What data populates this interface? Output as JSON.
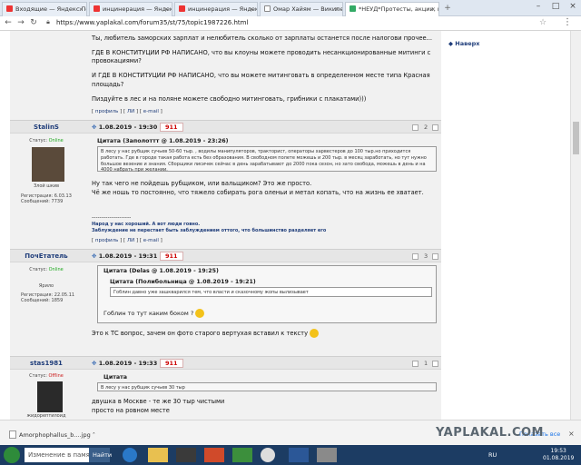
{
  "browser": {
    "tabs": [
      {
        "label": "Входящие — Яндекс.Почта"
      },
      {
        "label": "инцинерация — Яндекс: нашлось"
      },
      {
        "label": "инцинерация — Яндекс нашлос"
      },
      {
        "label": "Омар Хайям — Википедия"
      },
      {
        "label": "*НЕУД*Протесты, акции, митинги"
      }
    ],
    "url": "https://www.yaplakal.com/forum35/st/75/topic1987226.html"
  },
  "right": {
    "up": "◆ Наверх"
  },
  "top_post": {
    "lines": [
      "Ты, любитель заморских зарплат и нелюбитель сколько от зарплаты останется после налогови прочее...",
      "ГДЕ В КОНСТИТУЦИИ РФ НАПИСАНО, что вы клоуны можете проводить несанкционированные митинги с провокациями?",
      "И ГДЕ В КОНСТИТУЦИИ РФ НАПИСАНО, что вы можете митинговать в определенном месте типа Красная площадь?",
      "Пиздуйте в лес и на поляне можете свободно митинговать, грибники с плакатами)))"
    ],
    "links": [
      "профиль",
      "ЛИ",
      "e-mail"
    ]
  },
  "posts": [
    {
      "nick": "StalinS",
      "status_label": "Статус:",
      "status": "Online",
      "rank": "Злой шкив",
      "reg": "Регистрация: 6.03.13",
      "msgs": "Сообщений: 7739",
      "date": "1.08.2019 - 19:30",
      "num": "911",
      "count": "2",
      "quote_title": "Цитата (Заполоттт @ 1.08.2019 - 23:26)",
      "quote": "В лесу у нас рубщик сучьев 50-60 тыр. , водилы манипуляторов, тракторист, операторы харвестеров до 100 тыр.но приходится работать. Где в городе такая работа есть без образования. В свободном полете можешь и 200 тыр. в месяц заработать, но тут нужно большое везение и знания. Сборщики лисичек сейчас в день зарабатывают до 2000 пока сезон, но зато свобода, можешь в день и на 4000 набрать при желании.",
      "text": [
        "Ну так чего не пойдешь рубщиком, или вальщиком? Это же просто.",
        "Чё же ношь то постоянно, что тяжело собирать рога оленьи и метал копать, что на жизнь ее хватает."
      ],
      "sig_sep": "--------------------",
      "sig1": "Народ у нас хороший. А вот люди говно.",
      "sig2": "Заблуждение не перестает быть заблуждением оттого, что большинство разделяет его",
      "links": [
        "профиль",
        "ЛИ",
        "e-mail"
      ]
    },
    {
      "nick": "ПочЕтатель",
      "status_label": "Статус:",
      "status": "Online",
      "rank": "Ярило",
      "reg": "Регистрация: 22.05.11",
      "msgs": "Сообщений: 1859",
      "date": "1.08.2019 - 19:31",
      "num": "911",
      "count": "3",
      "quote_title": "Цитата (Delas @ 1.08.2019 - 19:25)",
      "inner_title": "Цитата (Полибольница @ 1.08.2019 - 19:21)",
      "inner": "Гоблин давно уже зашкварился тем, что власти и сказочному жопы вылизывает",
      "mid": "Гоблин то тут каким боком ?",
      "text": [
        "Это к ТС вопрос, зачем он фото старого вертухая вставил к тексту"
      ],
      "links": [
        "профиль",
        "ЛИ",
        "e-mail"
      ]
    },
    {
      "nick": "stas1981",
      "status_label": "Статус:",
      "status": "Offline",
      "rank": "жидорептилоид",
      "date": "1.08.2019 - 19:33",
      "num": "911",
      "count": "1",
      "quote_title": "Цитата",
      "quote": "В лесу у нас рубщик сучьев 30 тыр",
      "text": [
        "двушка в Москве - те же 30 тыр чистыми",
        "просто на ровном месте"
      ]
    }
  ],
  "download": {
    "file": "Amorphophallus_b....jpg",
    "show_all": "Показать все"
  },
  "watermark": "YAPLAKAL.COM",
  "taskbar": {
    "search_placeholder": "Изменение в памяти...",
    "go": "Найти",
    "lang": "RU",
    "time": "19:53",
    "date": "01.08.2019"
  },
  "colors": {
    "accent": "#1f3d7a",
    "num": "#cc0000",
    "taskbar": "#1c3c63"
  }
}
